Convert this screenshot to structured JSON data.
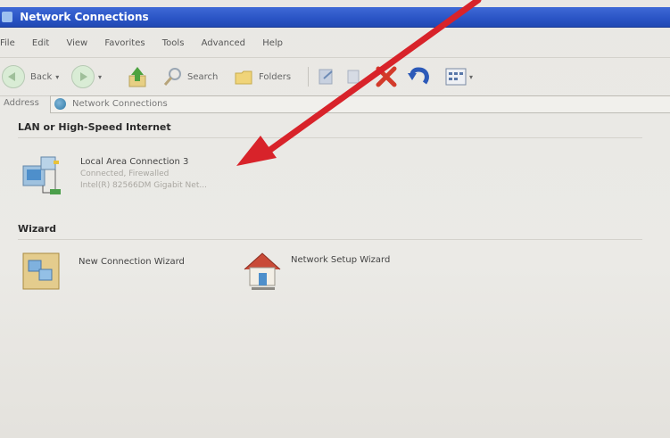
{
  "window": {
    "title": "Network Connections"
  },
  "menu": [
    "File",
    "Edit",
    "View",
    "Favorites",
    "Tools",
    "Advanced",
    "Help"
  ],
  "toolbar": {
    "back": "Back",
    "search": "Search",
    "folders": "Folders"
  },
  "address": {
    "label": "Address",
    "value": "Network Connections"
  },
  "groups": {
    "lan": {
      "header": "LAN or High-Speed Internet",
      "items": [
        {
          "title": "Local Area Connection 3",
          "status": "Connected, Firewalled",
          "device": "Intel(R) 82566DM Gigabit Net..."
        }
      ]
    },
    "wizard": {
      "header": "Wizard",
      "items": [
        {
          "title": "New Connection Wizard"
        },
        {
          "title": "Network Setup Wizard"
        }
      ]
    }
  },
  "colors": {
    "titlebar": "#2b55c6",
    "arrow": "#d8232a"
  }
}
